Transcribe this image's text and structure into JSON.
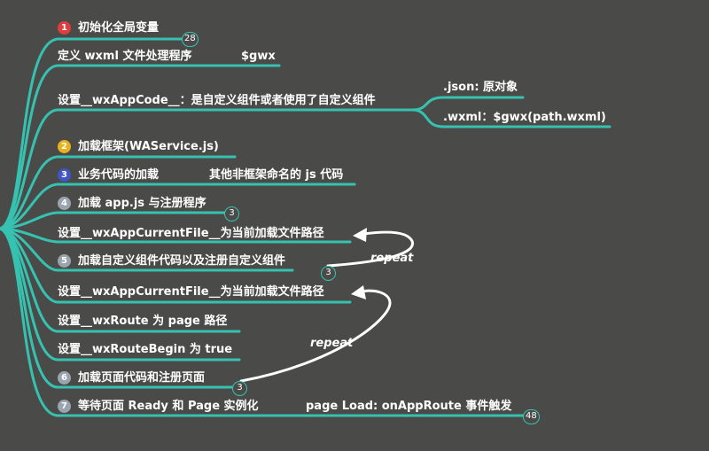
{
  "colors": {
    "background": "#4a4b49",
    "branch": "#36c2b0",
    "text": "#ffffff",
    "arrow": "#ffffff"
  },
  "nodes": {
    "n1": {
      "step": "1",
      "step_color": "#e03e3e",
      "label": "初始化全局变量",
      "badge": "28"
    },
    "n1a": {
      "label": "定义 wxml 文件处理程序",
      "extra": "$gwx"
    },
    "n1b": {
      "label": "设置__wxAppCode__：是自定义组件或者使用了自定义组件"
    },
    "n1b1": {
      "label": ".json: 原对象"
    },
    "n1b2": {
      "label": ".wxml：$gwx(path.wxml)"
    },
    "n2": {
      "step": "2",
      "step_color": "#e8b21e",
      "label": "加载框架(WAService.js)"
    },
    "n3": {
      "step": "3",
      "step_color": "#4255c4",
      "label": "业务代码的加载",
      "extra": "其他非框架命名的 js 代码"
    },
    "n4": {
      "step": "4",
      "step_color": "#9aa4ae",
      "label": "加载 app.js 与注册程序",
      "badge": "3"
    },
    "n4a": {
      "label": "设置__wxAppCurrentFile__为当前加载文件路径"
    },
    "n5": {
      "step": "5",
      "step_color": "#9aa4ae",
      "label": "加载自定义组件代码以及注册自定义组件",
      "badge": "3"
    },
    "n5a": {
      "label": "设置__wxAppCurrentFile__为当前加载文件路径"
    },
    "n5b": {
      "label": "设置__wxRoute 为 page 路径"
    },
    "n5c": {
      "label": "设置__wxRouteBegin 为 true"
    },
    "n6": {
      "step": "6",
      "step_color": "#9aa4ae",
      "label": "加载页面代码和注册页面",
      "badge": "3"
    },
    "n7": {
      "step": "7",
      "step_color": "#9aa4ae",
      "label": "等待页面 Ready 和 Page 实例化",
      "extra": "page Load: onAppRoute 事件触发",
      "badge": "48"
    }
  },
  "annotations": {
    "repeat_1": "repeat",
    "repeat_2": "repeat"
  }
}
